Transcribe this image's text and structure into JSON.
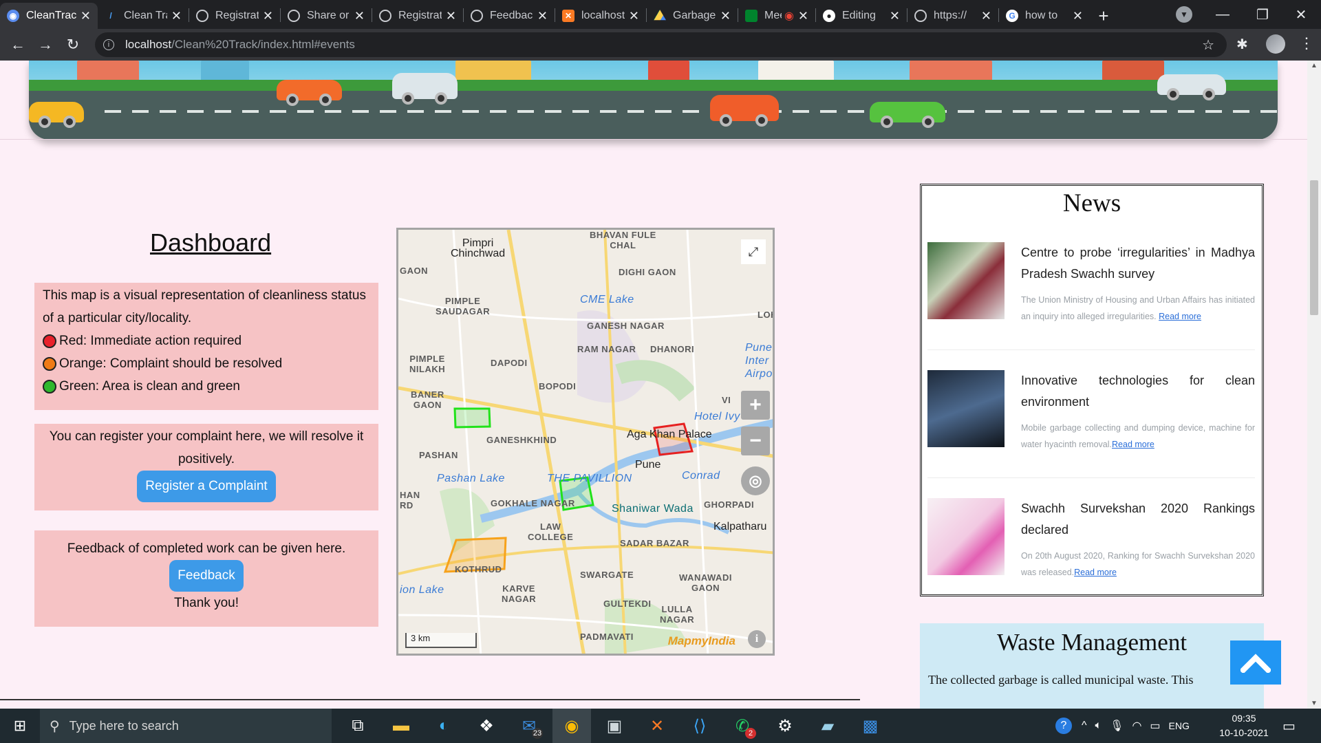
{
  "browser": {
    "tabs": [
      {
        "label": "CleanTrack",
        "active": true
      },
      {
        "label": "Clean Track"
      },
      {
        "label": "Registration"
      },
      {
        "label": "Share or embed"
      },
      {
        "label": "Registration"
      },
      {
        "label": "Feedback"
      },
      {
        "label": "localhost"
      },
      {
        "label": "Garbage"
      },
      {
        "label": "Meet"
      },
      {
        "label": "Editing"
      },
      {
        "label": "https://"
      },
      {
        "label": "how to"
      }
    ],
    "url_host": "localhost",
    "url_path": "/Clean%20Track/index.html#events"
  },
  "dashboard": {
    "title": "Dashboard",
    "intro": "This map is a visual representation of cleanliness status of a particular city/locality.",
    "legend": [
      {
        "color": "#e8212b",
        "label": "Red: Immediate action required"
      },
      {
        "color": "#f07b16",
        "label": "Orange: Complaint should be resolved"
      },
      {
        "color": "#2fb82d",
        "label": "Green: Area is clean and green"
      }
    ],
    "complaint_text": "You can register your complaint here, we will resolve it positively.",
    "complaint_button": "Register a Complaint",
    "feedback_text": "Feedback of completed work can be given here.",
    "feedback_button": "Feedback",
    "thanks": "Thank you!"
  },
  "map": {
    "labels": {
      "pimpri": "Pimpri\nChinchwad",
      "bhavan": "BHAVAN FULE\nCHAL",
      "gaon": "GAON",
      "digh": "DIGHI GAON",
      "pimple_s": "PIMPLE\nSAUDAGAR",
      "cme": "CME Lake",
      "ganesh": "GANESH NAGAR",
      "loh": "LOH",
      "ram": "RAM NAGAR",
      "dhanori": "DHANORI",
      "pimple_n": "PIMPLE\nNILAKH",
      "dapodi": "DAPODI",
      "pune_air": "Pune\nInter\nAirpo",
      "baner": "BANER\nGAON",
      "bopodi": "BOPODI",
      "vi": "VI",
      "hotel": "Hotel Ivy",
      "ganeshkhind": "GANESHKHIND",
      "aga": "Aga Khan Palace",
      "pashan": "PASHAN",
      "pune": "Pune",
      "pashan_lake": "Pashan Lake",
      "pavillion": "THE PAVILLION",
      "conrad": "Conrad",
      "han": "HAN\nRD",
      "gokhale": "GOKHALE NAGAR",
      "shaniwar": "Shaniwar Wada",
      "ghorpadi": "GHORPADI",
      "kalpatharu": "Kalpatharu",
      "law": "LAW\nCOLLEGE",
      "sadar": "SADAR BAZAR",
      "kothrud": "KOTHRUD",
      "karve": "KARVE\nNAGAR",
      "swargate": "SWARGATE",
      "wanawadi": "WANAWADI\nGAON",
      "ion": "ion Lake",
      "gultekdi": "GULTEKDI",
      "lulla": "LULLA\nNAGAR",
      "padmavati": "PADMAVATI"
    },
    "scale": "3 km",
    "brand": "MapmyIndia",
    "zoom_in": "+",
    "zoom_out": "−"
  },
  "news": {
    "title": "News",
    "items": [
      {
        "headline": "Centre to probe ‘irregularities’ in Madhya Pradesh Swachh survey",
        "desc": "The Union Ministry of Housing and Urban Affairs has initiated an inquiry into alleged irregularities.",
        "link": "Read more"
      },
      {
        "headline": "Innovative technologies for clean environment",
        "desc": "Mobile garbage collecting and dumping device, machine for water hyacinth removal.",
        "link": "Read more"
      },
      {
        "headline": "Swachh Survekshan 2020 Rankings declared",
        "desc": "On 20th August 2020, Ranking for Swachh Survekshan 2020 was released.",
        "link": "Read more"
      }
    ]
  },
  "waste": {
    "title": "Waste Management",
    "text": "The collected garbage is called municipal waste. This"
  },
  "taskbar": {
    "search_placeholder": "Type here to search",
    "mail_badge": "23",
    "whatsapp_badge": "2",
    "lang": "ENG",
    "time": "09:35",
    "date": "10-10-2021"
  }
}
